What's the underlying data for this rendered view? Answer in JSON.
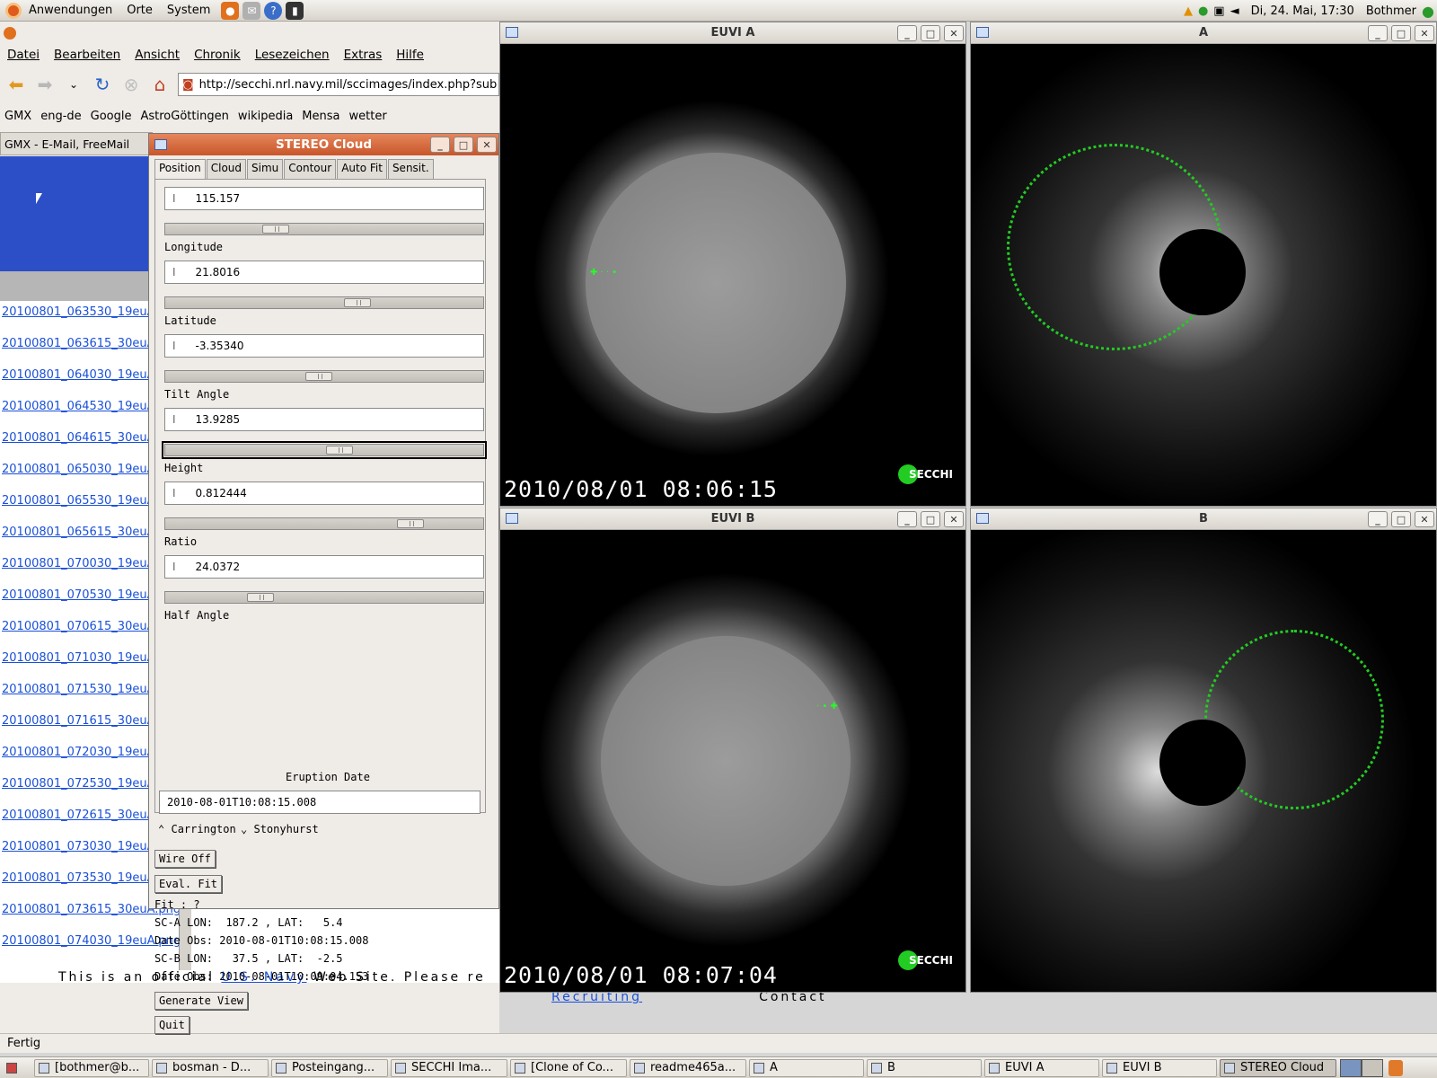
{
  "top_panel": {
    "menus": [
      "Anwendungen",
      "Orte",
      "System"
    ],
    "datetime": "Di, 24. Mai, 17:30",
    "user": "Bothmer"
  },
  "browser": {
    "menu": [
      "Datei",
      "Bearbeiten",
      "Ansicht",
      "Chronik",
      "Lesezeichen",
      "Extras",
      "Hilfe"
    ],
    "url": "http://secchi.nrl.navy.mil/sccimages/index.php?sub",
    "bookmarks": [
      "GMX",
      "eng-de",
      "Google",
      "AstroGöttingen",
      "wikipedia",
      "Mensa",
      "wetter"
    ],
    "tab": "GMX - E-Mail, FreeMail",
    "files": [
      "20100801_063530_19euA",
      "20100801_063615_30euA",
      "20100801_064030_19euA",
      "20100801_064530_19euA",
      "20100801_064615_30euA",
      "20100801_065030_19euA",
      "20100801_065530_19euA",
      "20100801_065615_30euA",
      "20100801_070030_19euA",
      "20100801_070530_19euA",
      "20100801_070615_30euA",
      "20100801_071030_19euA",
      "20100801_071530_19euA",
      "20100801_071615_30euA",
      "20100801_072030_19euA",
      "20100801_072530_19euA",
      "20100801_072615_30euA",
      "20100801_073030_19euA",
      "20100801_073530_19euA",
      "20100801_073615_30euA.png",
      "20100801_074030_19euA.png"
    ],
    "footer_text": "This is an official",
    "footer_link": "U.S. Navy",
    "footer_text2": "Web Site. Please re",
    "recruiting": "Recruiting",
    "contact": "Contact",
    "status": "Fertig"
  },
  "windows": {
    "euvi_a": {
      "title": "EUVI A",
      "timestamp": "2010/08/01 08:06:15",
      "logo": "SECCHI"
    },
    "a": {
      "title": "A"
    },
    "euvi_b": {
      "title": "EUVI B",
      "timestamp": "2010/08/01 08:07:04",
      "logo": "SECCHI"
    },
    "b": {
      "title": "B"
    }
  },
  "stereo_cloud": {
    "title": "STEREO Cloud",
    "tabs": [
      "Position",
      "Cloud",
      "Simu",
      "Contour",
      "Auto Fit",
      "Sensit."
    ],
    "params": [
      {
        "value": "115.157",
        "label": "Longitude",
        "slider": 0.33
      },
      {
        "value": "21.8016",
        "label": "Latitude",
        "slider": 0.61
      },
      {
        "value": "-3.35340",
        "label": "Tilt Angle",
        "slider": 0.48
      },
      {
        "value": "13.9285",
        "label": "Height",
        "slider": 0.55
      },
      {
        "value": "0.812444",
        "label": "Ratio",
        "slider": 0.79
      },
      {
        "value": "24.0372",
        "label": "Half Angle",
        "slider": 0.28
      }
    ],
    "eruption_label": "Eruption Date",
    "eruption_value": "2010-08-01T10:08:15.008",
    "radio_carrington": "Carrington",
    "radio_stonyhurst": "Stonyhurst",
    "btn_wire": "Wire Off",
    "btn_eval": "Eval. Fit",
    "fit": "Fit : ?",
    "sca": "SC-A LON:  187.2 , LAT:   5.4",
    "date_a": "Date Obs: 2010-08-01T10:08:15.008",
    "scb": "SC-B LON:   37.5 , LAT:  -2.5",
    "date_b": "Date Obs: 2010-08-01T10:09:04.153",
    "btn_generate": "Generate View",
    "btn_quit": "Quit"
  },
  "taskbar": [
    "[bothmer@b...",
    "bosman - D...",
    "Posteingang...",
    "SECCHI Ima...",
    "[Clone of Co...",
    "readme465a...",
    "A",
    "B",
    "EUVI A",
    "EUVI B",
    "STEREO Cloud"
  ]
}
